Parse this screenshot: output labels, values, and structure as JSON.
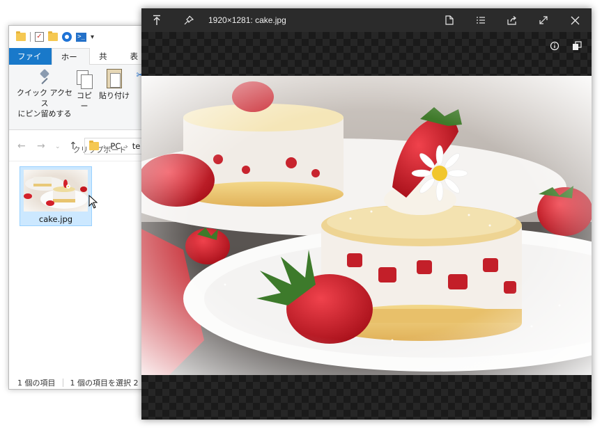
{
  "explorer": {
    "tabs": {
      "file": "ファイル",
      "home": "ホーム",
      "share": "共有",
      "view": "表"
    },
    "ribbon": {
      "pin_line1": "クイック アクセス",
      "pin_line2": "にピン留めする",
      "copy": "コピー",
      "paste": "貼り付け",
      "group_label": "クリップボード"
    },
    "address": {
      "pc": "PC",
      "folder": "te"
    },
    "file": {
      "name": "cake.jpg"
    },
    "status": {
      "count": "1 個の項目",
      "selected": "1 個の項目を選択 2"
    }
  },
  "viewer": {
    "title": "1920×1281: cake.jpg",
    "icons": [
      "always-on-top-icon",
      "pin-icon",
      "new-file-icon",
      "list-icon",
      "share-icon",
      "fullscreen-icon",
      "close-icon",
      "info-icon",
      "copy-icon"
    ]
  },
  "colors": {
    "file_tab": "#1979ca",
    "selection": "#cce8ff",
    "viewer_bg": "#1b1b1b"
  }
}
